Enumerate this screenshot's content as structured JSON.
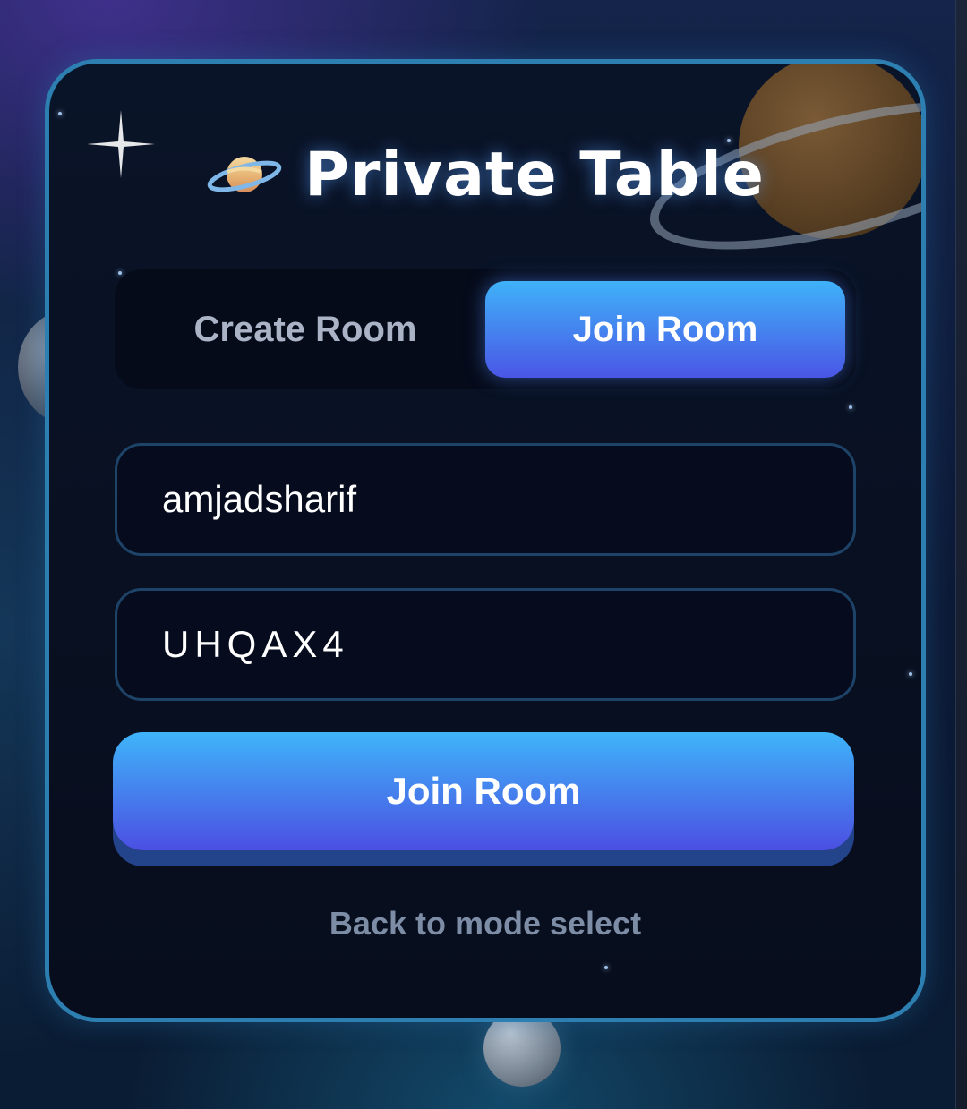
{
  "app": {
    "title": "Private Table",
    "title_icon": "saturn-planet-icon"
  },
  "mode_toggle": {
    "options": [
      {
        "label": "Create Room",
        "active": false
      },
      {
        "label": "Join Room",
        "active": true
      }
    ]
  },
  "form": {
    "player_name": {
      "value": "amjadsharif"
    },
    "room_code": {
      "value": "UHQAX4"
    },
    "submit_label": "Join Room"
  },
  "footer": {
    "back_label": "Back to mode select"
  },
  "colors": {
    "accent_top": "#3fb2f8",
    "accent_bottom": "#4a56e6",
    "card_border": "#2c7fb0",
    "muted_text": "#7d8da6"
  }
}
